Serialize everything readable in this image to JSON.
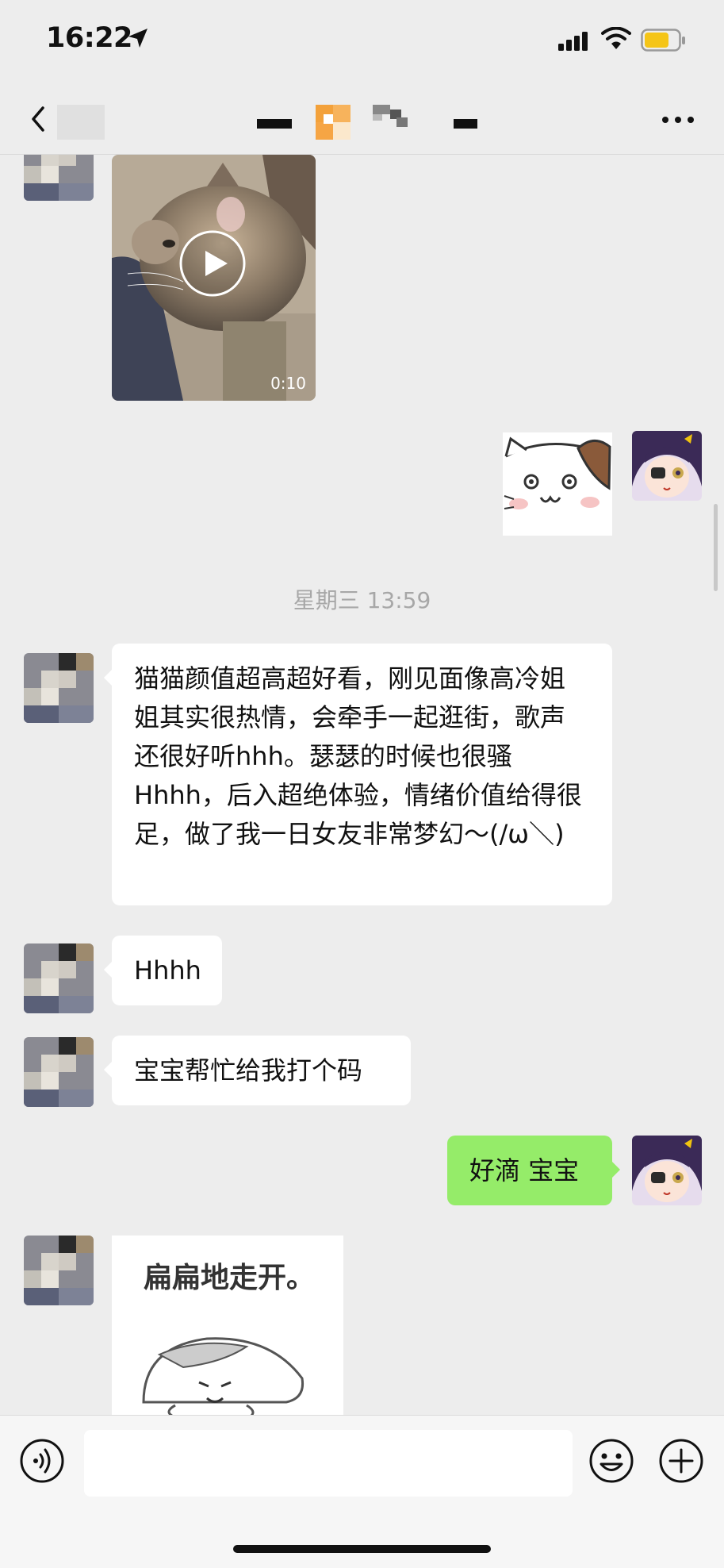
{
  "status_bar": {
    "time": "16:22"
  },
  "nav": {
    "title": ""
  },
  "video": {
    "duration": "0:10"
  },
  "timestamp": "星期三 13:59",
  "messages": {
    "review": "猫猫颜值超高超好看，刚见面像高冷姐姐其实很热情，会牵手一起逛街，歌声还很好听hhh。瑟瑟的时候也很骚Hhhh，后入超绝体验，情绪价值给得很足，做了我一日女友非常梦幻～(/ω＼)",
    "hhhh": "Hhhh",
    "ask_code": "宝宝帮忙给我打个码",
    "reply": "好滴 宝宝"
  },
  "sticker_bottom": {
    "caption": "扁扁地走开。"
  },
  "input": {
    "placeholder": ""
  },
  "colors": {
    "self_bubble": "#95ec69",
    "background": "#ededed",
    "bubble": "#ffffff"
  }
}
